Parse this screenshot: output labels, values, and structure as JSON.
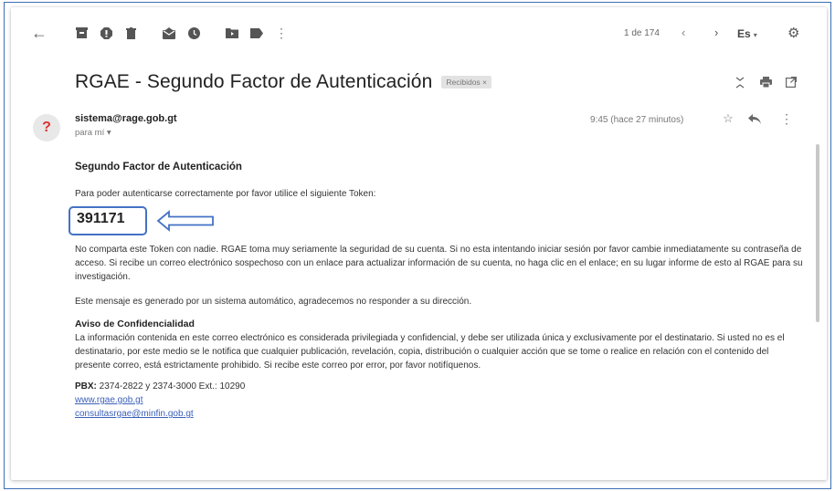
{
  "toolbar": {
    "back_icon": "arrow-left-icon",
    "counter": "1 de 174",
    "prev_icon": "chevron-left-icon",
    "next_icon": "chevron-right-icon",
    "language": "Es",
    "settings_icon": "gear-icon"
  },
  "email": {
    "subject": "RGAE - Segundo Factor de Autenticación",
    "label": "Recibidos ×",
    "sender": "sistema@rage.gob.gt",
    "recipient": "para mí ▾",
    "time": "9:45 (hace 27 minutos)",
    "avatar_text": "?"
  },
  "body": {
    "heading": "Segundo Factor de Autenticación",
    "intro": "Para poder autenticarse correctamente por favor utilice el siguiente Token:",
    "token": "391171",
    "warning": "No comparta este Token con nadie. RGAE toma muy seriamente la seguridad de su cuenta. Si no esta intentando iniciar sesión por favor cambie inmediatamente su contraseña de acceso. Si recibe un correo electrónico sospechoso con un enlace para actualizar información de su cuenta, no haga clic en el enlace; en su lugar informe de esto al RGAE para su investigación.",
    "auto_message": "Este mensaje es generado por un sistema automático, agradecemos no responder a su dirección.",
    "aviso_title": "Aviso de Confidencialidad",
    "aviso_text": "La información contenida en este correo electrónico es considerada privilegiada y confidencial, y debe ser utilizada única y exclusivamente por el destinatario. Si usted no es el destinatario, por este medio se le notifica que cualquier publicación, revelación, copia, distribución o cualquier acción que se tome o realice en relación con el contenido del presente correo, está estrictamente prohibido. Si recibe este correo por error, por favor notifíquenos.",
    "pbx_label": "PBX:",
    "pbx_value": " 2374-2822 y 2374-3000 Ext.: 10290",
    "website": "www.rgae.gob.gt",
    "contact_email": "consultasrgae@minfin.gob.gt"
  },
  "colors": {
    "highlight": "#4472c4",
    "link": "#3b5fb8",
    "avatar_question": "#dd3333"
  }
}
